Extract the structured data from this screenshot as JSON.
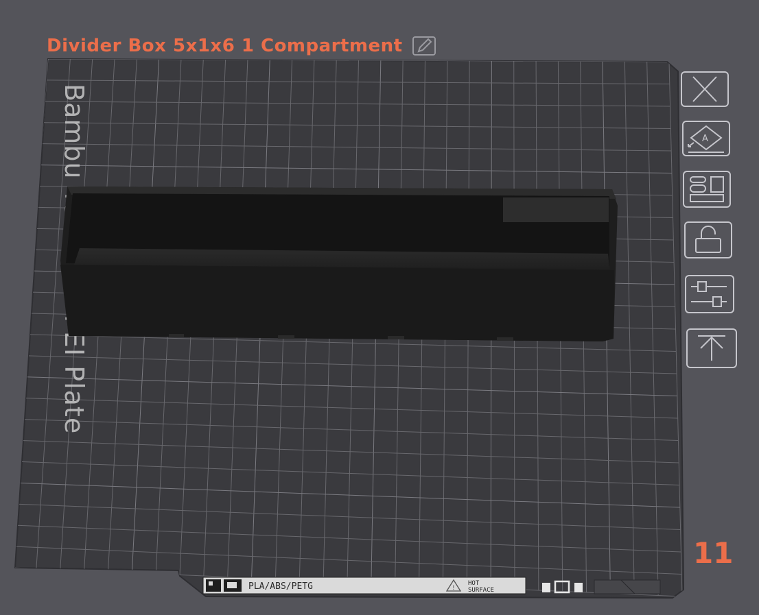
{
  "plate": {
    "title": "Divider Box 5x1x6 1 Compartment",
    "number": "11",
    "bed_label": "Bambu Textured PEI Plate",
    "bed_sticker": {
      "materials": "PLA/ABS/PETG",
      "hot_line1": "HOT",
      "hot_line2": "SURFACE"
    }
  },
  "toolbar": {
    "buttons": [
      {
        "icon": "close-icon"
      },
      {
        "icon": "auto-orient-icon"
      },
      {
        "icon": "arrange-icon"
      },
      {
        "icon": "lock-icon"
      },
      {
        "icon": "settings-sliders-icon"
      },
      {
        "icon": "move-to-top-icon"
      }
    ]
  },
  "colors": {
    "background": "#54545a",
    "plate": "#39393d",
    "grid": "#66666b",
    "accent": "#ec6e4a",
    "model": "#1c1c1c"
  }
}
